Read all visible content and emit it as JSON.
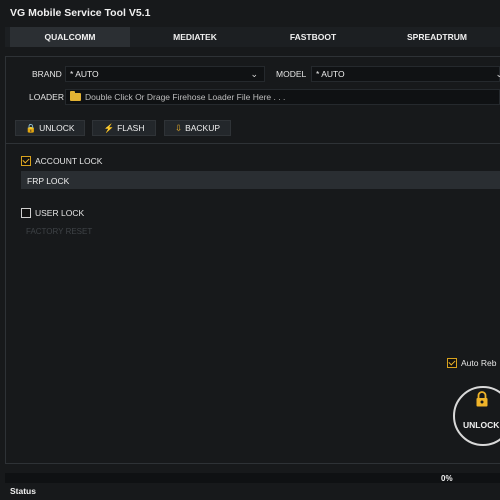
{
  "app": {
    "title": "VG Mobile Service Tool V5.1"
  },
  "tabs": [
    {
      "label": "QUALCOMM",
      "active": true
    },
    {
      "label": "MEDIATEK",
      "active": false
    },
    {
      "label": "FASTBOOT",
      "active": false
    },
    {
      "label": "SPREADTRUM",
      "active": false
    }
  ],
  "form": {
    "brand_label": "BRAND",
    "brand_value": "* AUTO",
    "model_label": "MODEL",
    "model_value": "* AUTO",
    "loader_label": "LOADER",
    "loader_placeholder": "Double Click Or Drage Firehose Loader File Here . . ."
  },
  "actions": {
    "unlock": "UNLOCK",
    "flash": "FLASH",
    "backup": "BACKUP"
  },
  "options": {
    "account_lock": {
      "label": "ACCOUNT LOCK",
      "checked": true
    },
    "frp_lock": "FRP LOCK",
    "user_lock": {
      "label": "USER LOCK",
      "checked": false
    },
    "factory_reset": "FACTORY RESET",
    "auto_reboot": {
      "label": "Auto Reb",
      "checked": true
    }
  },
  "big_button": {
    "label": "UNLOCK"
  },
  "progress": {
    "value": 0,
    "text": "0%"
  },
  "status": {
    "label": "Status"
  },
  "colors": {
    "accent": "#f0b429",
    "background": "#17191b",
    "tab_active": "#2b2f33"
  }
}
